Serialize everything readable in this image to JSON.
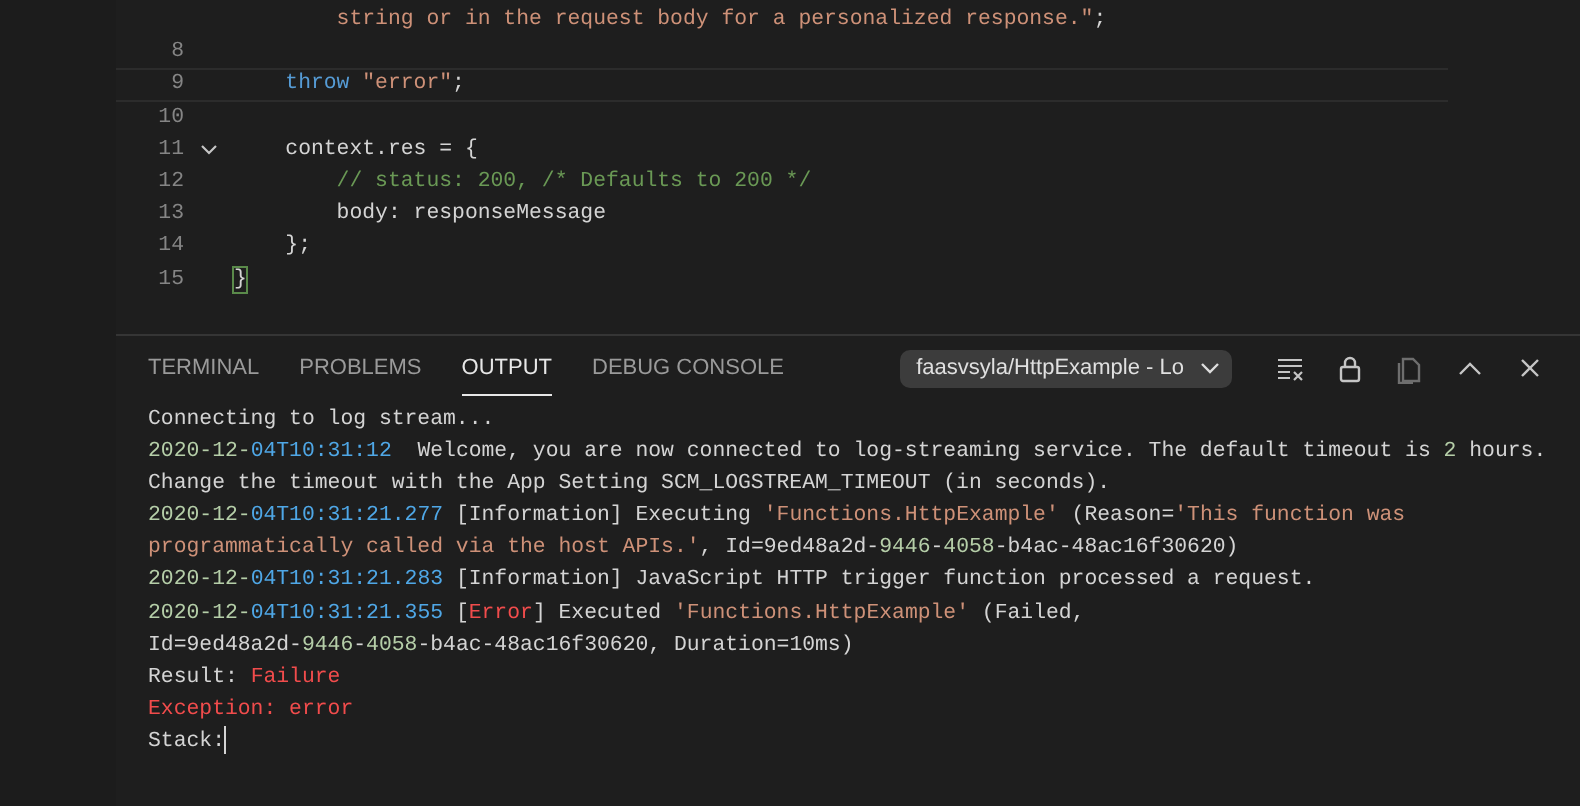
{
  "editor": {
    "lines": [
      {
        "segments": [
          {
            "kind": "string",
            "text": "        string or in the request body for a personalized response.\""
          },
          {
            "kind": "plain",
            "text": ";"
          }
        ]
      },
      {
        "number": "8"
      },
      {
        "number": "9",
        "active": true,
        "segments": [
          {
            "kind": "keyword",
            "text": "    throw"
          },
          {
            "kind": "string",
            "text": " \"error\""
          },
          {
            "kind": "plain",
            "text": ";"
          }
        ]
      },
      {
        "number": "10"
      },
      {
        "number": "11",
        "foldable": true,
        "segments": [
          {
            "kind": "plain",
            "text": "    context.res = {"
          }
        ]
      },
      {
        "number": "12",
        "segments": [
          {
            "kind": "comment",
            "text": "        // status: 200, /* Defaults to 200 */"
          }
        ]
      },
      {
        "number": "13",
        "segments": [
          {
            "kind": "plain",
            "text": "        body: responseMessage"
          }
        ]
      },
      {
        "number": "14",
        "segments": [
          {
            "kind": "plain",
            "text": "    };"
          }
        ]
      },
      {
        "number": "15",
        "segments": [
          {
            "kind": "bracket",
            "text": "}"
          }
        ]
      }
    ]
  },
  "panel": {
    "tabs": [
      {
        "label": "TERMINAL",
        "selected": false
      },
      {
        "label": "PROBLEMS",
        "selected": false
      },
      {
        "label": "OUTPUT",
        "selected": true
      },
      {
        "label": "DEBUG CONSOLE",
        "selected": false
      }
    ],
    "channel_select": {
      "value": "faasvsyla/HttpExample - Lo"
    },
    "output": [
      [
        {
          "kind": "plain",
          "text": "Connecting to log stream..."
        }
      ],
      [
        {
          "kind": "date",
          "text": "2020-12-"
        },
        {
          "kind": "time",
          "text": "04T10:31:12"
        },
        {
          "kind": "plain",
          "text": "  Welcome, you are now connected to log-streaming service. The default timeout is "
        },
        {
          "kind": "number",
          "text": "2"
        },
        {
          "kind": "plain",
          "text": " hours."
        }
      ],
      [
        {
          "kind": "plain",
          "text": "Change the timeout with the App Setting SCM_LOGSTREAM_TIMEOUT (in seconds)."
        }
      ],
      [
        {
          "kind": "date",
          "text": "2020-12-"
        },
        {
          "kind": "time",
          "text": "04T10:31:21.277"
        },
        {
          "kind": "plain",
          "text": " [Information] Executing "
        },
        {
          "kind": "string",
          "text": "'Functions.HttpExample'"
        },
        {
          "kind": "plain",
          "text": " (Reason="
        },
        {
          "kind": "string",
          "text": "'This function was"
        }
      ],
      [
        {
          "kind": "string",
          "text": "programmatically called via the host APIs.'"
        },
        {
          "kind": "plain",
          "text": ", Id=9ed48a2d-"
        },
        {
          "kind": "number",
          "text": "9446"
        },
        {
          "kind": "plain",
          "text": "-"
        },
        {
          "kind": "number",
          "text": "4058"
        },
        {
          "kind": "plain",
          "text": "-b4ac-48ac16f30620)"
        }
      ],
      [
        {
          "kind": "date",
          "text": "2020-12-"
        },
        {
          "kind": "time",
          "text": "04T10:31:21.283"
        },
        {
          "kind": "plain",
          "text": " [Information] JavaScript HTTP trigger function processed a request."
        }
      ],
      [
        {
          "kind": "date",
          "text": "2020-12-"
        },
        {
          "kind": "time",
          "text": "04T10:31:21.355"
        },
        {
          "kind": "plain",
          "text": " ["
        },
        {
          "kind": "error",
          "text": "Error"
        },
        {
          "kind": "plain",
          "text": "] Executed "
        },
        {
          "kind": "string",
          "text": "'Functions.HttpExample'"
        },
        {
          "kind": "plain",
          "text": " (Failed,"
        }
      ],
      [
        {
          "kind": "plain",
          "text": "Id=9ed48a2d-"
        },
        {
          "kind": "number",
          "text": "9446"
        },
        {
          "kind": "plain",
          "text": "-"
        },
        {
          "kind": "number",
          "text": "4058"
        },
        {
          "kind": "plain",
          "text": "-b4ac-48ac16f30620, Duration=10ms)"
        }
      ],
      [
        {
          "kind": "plain",
          "text": "Result: "
        },
        {
          "kind": "error",
          "text": "Failure"
        }
      ],
      [
        {
          "kind": "error",
          "text": "Exception: error"
        }
      ],
      [
        {
          "kind": "plain",
          "text": "Stack:"
        }
      ]
    ]
  }
}
